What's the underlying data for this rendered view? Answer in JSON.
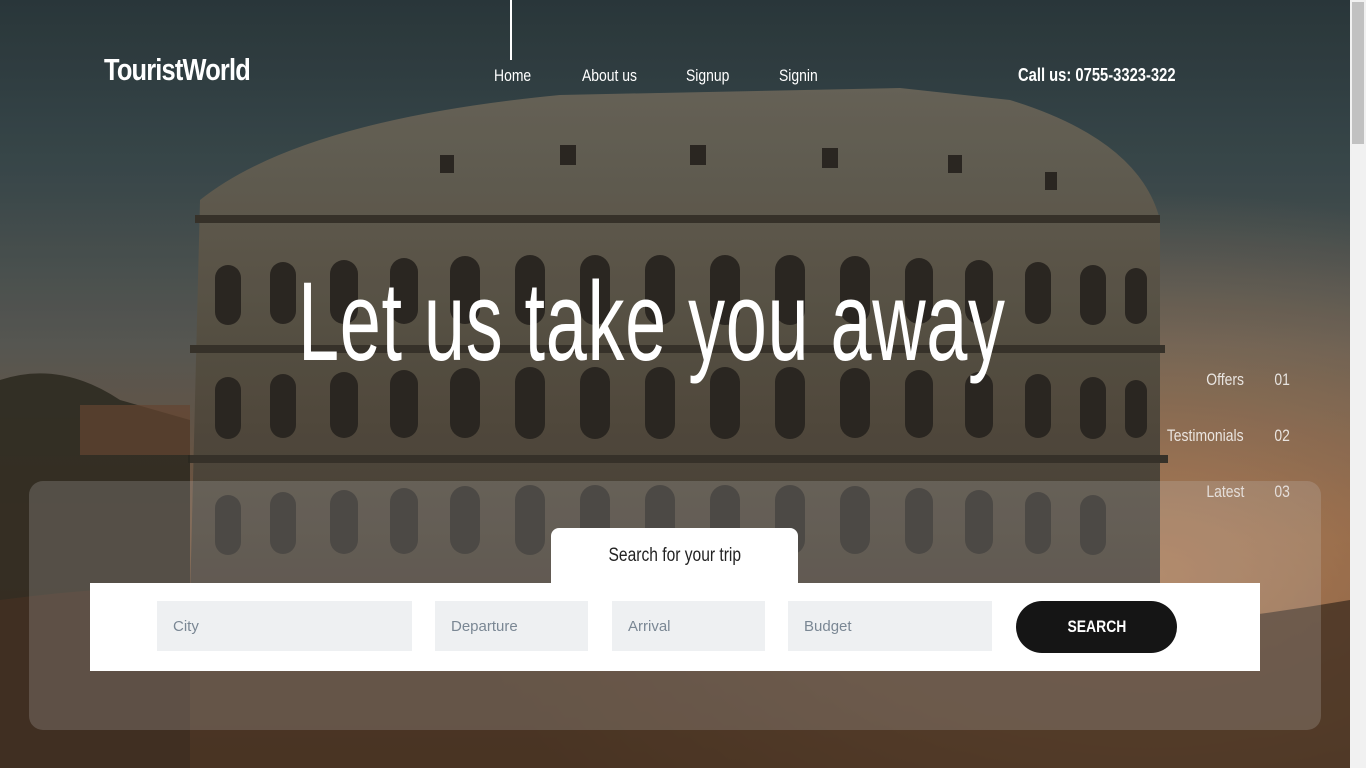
{
  "brand": {
    "name": "TouristWorld"
  },
  "nav": {
    "items": [
      {
        "label": "Home",
        "active": true
      },
      {
        "label": "About us",
        "active": false
      },
      {
        "label": "Signup",
        "active": false
      },
      {
        "label": "Signin",
        "active": false
      }
    ]
  },
  "contact": {
    "phone_text": "Call us: 0755-3323-322"
  },
  "hero": {
    "title": "Let us take you away",
    "background": "colosseum-at-dusk"
  },
  "side_nav": [
    {
      "label": "Offers",
      "number": "01"
    },
    {
      "label": "Testimonials",
      "number": "02"
    },
    {
      "label": "Latest",
      "number": "03"
    }
  ],
  "search": {
    "tab_label": "Search for your trip",
    "fields": {
      "city": {
        "placeholder": "City",
        "value": ""
      },
      "departure": {
        "placeholder": "Departure",
        "value": ""
      },
      "arrival": {
        "placeholder": "Arrival",
        "value": ""
      },
      "budget": {
        "placeholder": "Budget",
        "value": ""
      }
    },
    "button_label": "SEARCH"
  },
  "colors": {
    "button_bg": "#151515",
    "field_bg": "#eef0f2",
    "text": "#ffffff"
  }
}
